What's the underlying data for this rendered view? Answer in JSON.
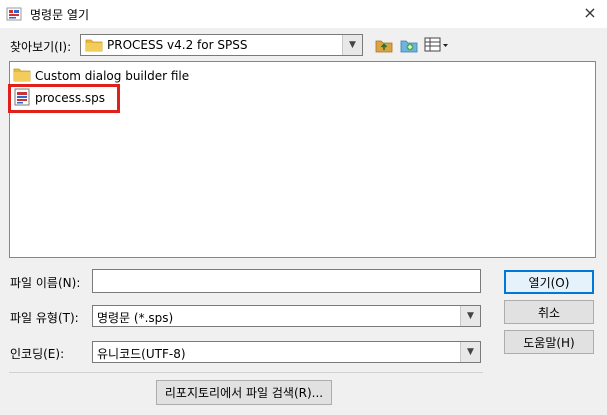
{
  "window": {
    "title": "명령문 열기",
    "close": "×"
  },
  "look_in": {
    "label": "찾아보기(I):",
    "value": "PROCESS v4.2 for SPSS"
  },
  "files": [
    {
      "name": "Custom dialog builder file",
      "type": "folder"
    },
    {
      "name": "process.sps",
      "type": "sps"
    }
  ],
  "file_name": {
    "label": "파일 이름(N):",
    "value": ""
  },
  "file_type": {
    "label": "파일 유형(T):",
    "value": "명령문 (*.sps)"
  },
  "encoding": {
    "label": "인코딩(E):",
    "value": "유니코드(UTF-8)"
  },
  "buttons": {
    "open": "열기(O)",
    "cancel": "취소",
    "help": "도움말(H)",
    "repo": "리포지토리에서 파일 검색(R)..."
  },
  "colors": {
    "highlight": "#e0201a",
    "default_button": "#0078d7",
    "folder": "#e8b93a"
  }
}
